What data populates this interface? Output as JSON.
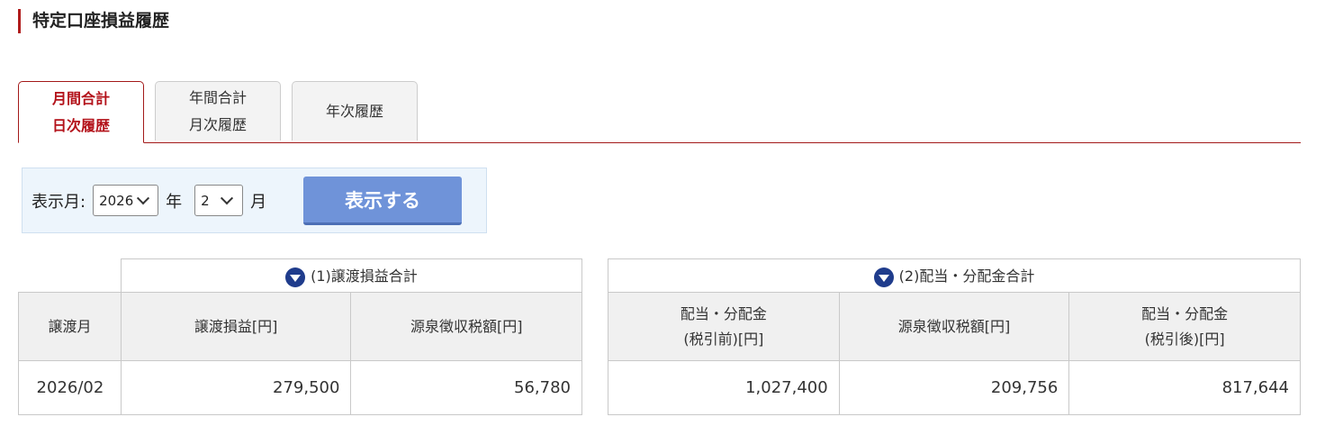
{
  "page": {
    "title": "特定口座損益履歴"
  },
  "tabs": [
    {
      "line1": "月間合計",
      "line2": "日次履歴",
      "active": true
    },
    {
      "line1": "年間合計",
      "line2": "月次履歴",
      "active": false
    },
    {
      "line1": "年次履歴",
      "line2": "",
      "active": false
    }
  ],
  "filter": {
    "label": "表示月:",
    "year_value": "2026",
    "year_unit": "年",
    "month_value": "2",
    "month_unit": "月",
    "submit_label": "表示する"
  },
  "table1": {
    "caption": "(1)譲渡損益合計",
    "col_month": "譲渡月",
    "col_pl": "譲渡損益[円]",
    "col_tax": "源泉徴収税額[円]",
    "row": {
      "month": "2026/02",
      "pl": "279,500",
      "tax": "56,780"
    }
  },
  "table2": {
    "caption": "(2)配当・分配金合計",
    "col_gross_l1": "配当・分配金",
    "col_gross_l2": "(税引前)[円]",
    "col_tax": "源泉徴収税額[円]",
    "col_net_l1": "配当・分配金",
    "col_net_l2": "(税引後)[円]",
    "row": {
      "gross": "1,027,400",
      "tax": "209,756",
      "net": "817,644"
    }
  }
}
